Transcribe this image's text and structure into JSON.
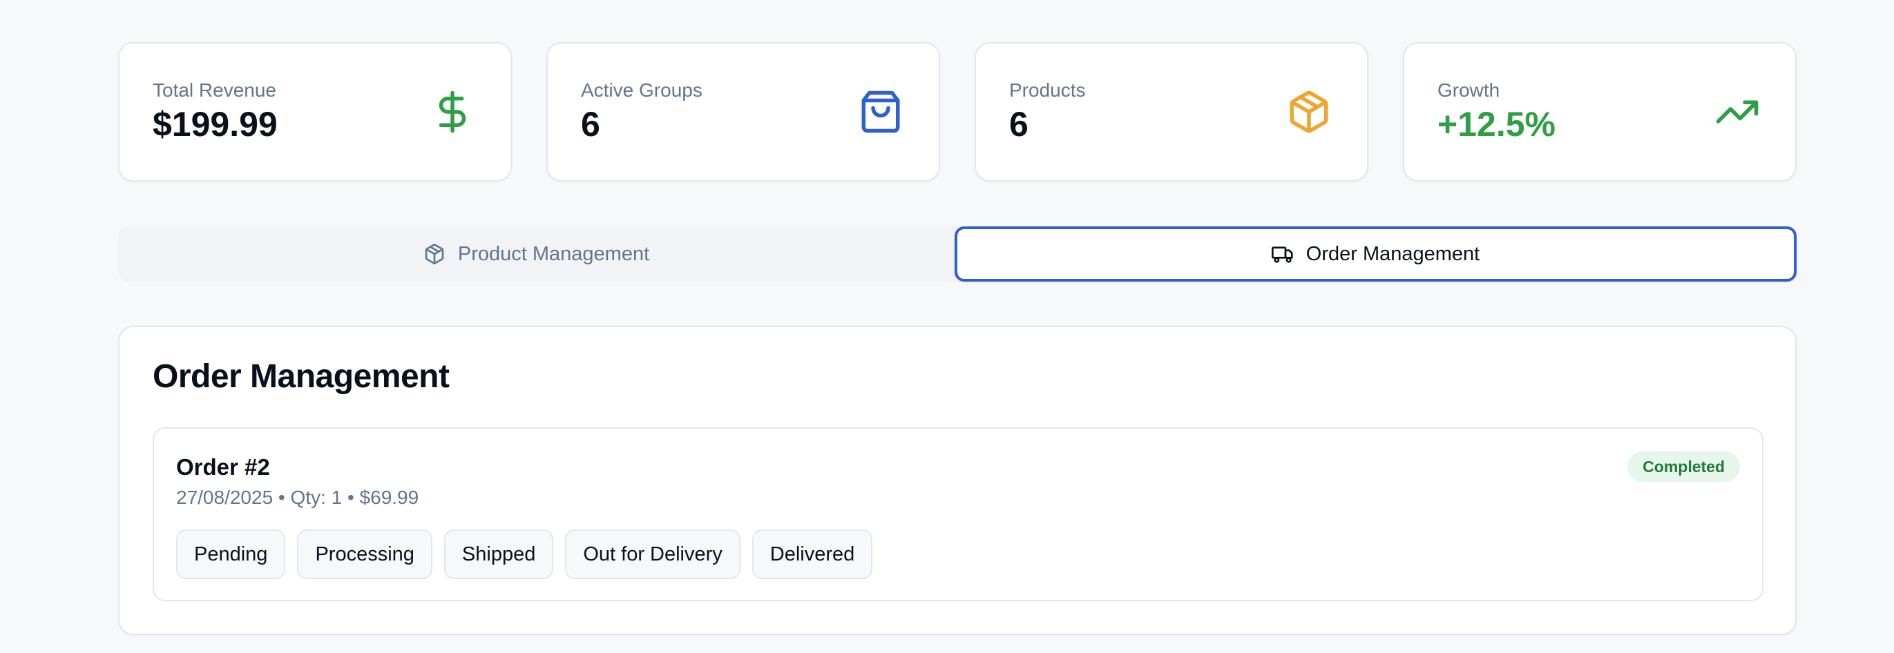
{
  "stats": [
    {
      "label": "Total Revenue",
      "value": "$199.99",
      "icon": "dollar-icon",
      "color": "#2f9e44",
      "value_color": "#0b0f19"
    },
    {
      "label": "Active Groups",
      "value": "6",
      "icon": "shopping-bag-icon",
      "color": "#2f5fd0",
      "value_color": "#0b0f19"
    },
    {
      "label": "Products",
      "value": "6",
      "icon": "package-icon",
      "color": "#f0a531",
      "value_color": "#0b0f19"
    },
    {
      "label": "Growth",
      "value": "+12.5%",
      "icon": "trending-up-icon",
      "color": "#2f9e44",
      "value_color": "#2f9e44"
    }
  ],
  "tabs": [
    {
      "label": "Product Management",
      "icon": "package-icon",
      "active": false
    },
    {
      "label": "Order Management",
      "icon": "truck-icon",
      "active": true
    }
  ],
  "order_panel": {
    "title": "Order Management",
    "order": {
      "title": "Order #2",
      "meta": "27/08/2025 • Qty: 1 • $69.99",
      "status": "Completed",
      "status_buttons": [
        "Pending",
        "Processing",
        "Shipped",
        "Out for Delivery",
        "Delivered"
      ]
    }
  },
  "colors": {
    "accent": "#2f5fd0",
    "success": "#2f9e44",
    "warning": "#f0a531",
    "badge_bg": "#e6f6ea",
    "badge_text": "#237a3b"
  }
}
